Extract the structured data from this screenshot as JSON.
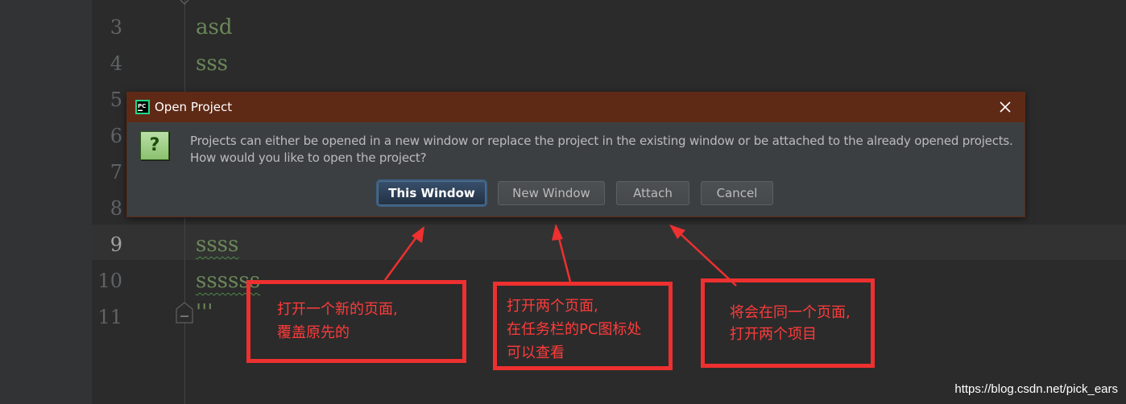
{
  "editor": {
    "line_numbers": [
      "3",
      "4",
      "5",
      "6",
      "7",
      "8",
      "9",
      "10",
      "11"
    ],
    "code_lines": {
      "l3": "asd",
      "l4": "sss",
      "l9": "ssss",
      "l10": "ssssss",
      "l11": "'''"
    }
  },
  "dialog": {
    "title": "Open Project",
    "app_icon": "pycharm-icon",
    "message_line1": "Projects can either be opened in a new window or replace the project in the existing window or be attached to the already opened projects.",
    "message_line2": "How would you like to open the project?",
    "question_icon": "?",
    "buttons": {
      "this_window": "This Window",
      "new_window": "New Window",
      "attach": "Attach",
      "cancel": "Cancel"
    }
  },
  "annotations": {
    "this_window": [
      "打开一个新的页面,",
      "覆盖原先的"
    ],
    "new_window": [
      "打开两个页面,",
      "在任务栏的PC图标处",
      "可以查看"
    ],
    "attach": [
      "将会在同一个页面,",
      "打开两个项目"
    ]
  },
  "watermark": "https://blog.csdn.net/pick_ears",
  "colors": {
    "editor_bg": "#2b2b2b",
    "dialog_title_bg": "#5e2a16",
    "annotation_red": "#ee3030",
    "string_green": "#6a8759"
  }
}
